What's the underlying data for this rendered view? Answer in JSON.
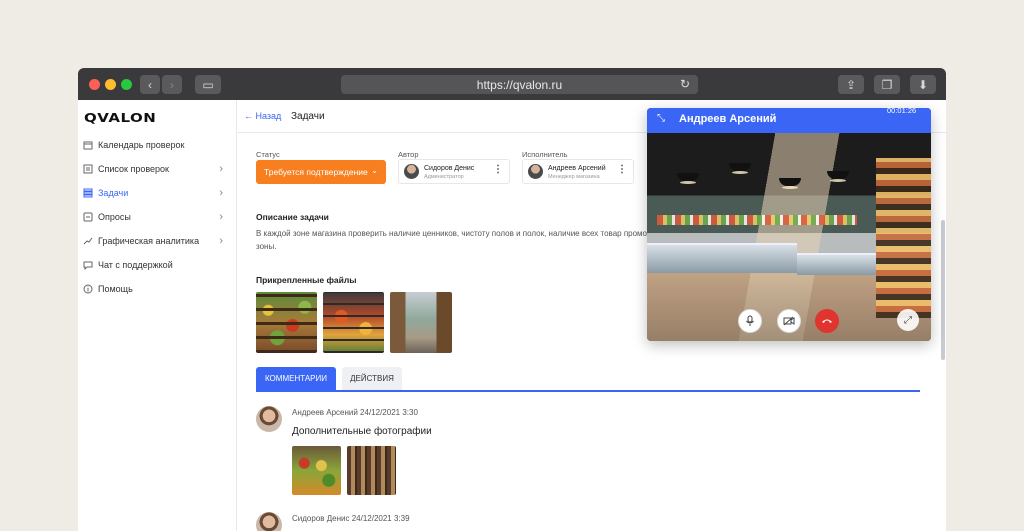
{
  "browser": {
    "url": "https://qvalon.ru"
  },
  "app": {
    "logo": "QVALON"
  },
  "sidebar": {
    "items": [
      {
        "label": "Календарь проверок",
        "icon": "calendar-icon"
      },
      {
        "label": "Список проверок",
        "icon": "checklist-icon"
      },
      {
        "label": "Задачи",
        "icon": "tasks-icon",
        "active": true
      },
      {
        "label": "Опросы",
        "icon": "survey-icon"
      },
      {
        "label": "Графическая аналитика",
        "icon": "chart-icon"
      },
      {
        "label": "Чат с поддержкой",
        "icon": "chat-icon"
      },
      {
        "label": "Помощь",
        "icon": "info-icon"
      }
    ]
  },
  "header": {
    "back_label": "Назад",
    "title": "Задачи"
  },
  "task": {
    "status_label": "Статус",
    "status_value": "Требуется подтверждение",
    "author_label": "Автор",
    "author": {
      "name": "Сидоров Денис",
      "role": "Администратор"
    },
    "assignee_label": "Исполнитель",
    "assignee": {
      "name": "Андреев Арсений",
      "role": "Менеджер магазина"
    },
    "description_title": "Описание задачи",
    "description": "В каждой зоне магазина проверить наличие ценников, чистоту полов и полок, наличие всех товар промо-зоны.",
    "files_title": "Прикрепленные файлы"
  },
  "tabs": [
    {
      "label": "КОММЕНТАРИИ",
      "active": true
    },
    {
      "label": "ДЕЙСТВИЯ",
      "active": false
    }
  ],
  "comments": [
    {
      "author_time": "Андреев Арсений 24/12/2021 3:30",
      "text": "Дополнительные фотографии"
    },
    {
      "author_time": "Сидоров Денис 24/12/2021 3:39",
      "text": ""
    }
  ],
  "call": {
    "name": "Андреев Арсений",
    "timer": "00:01:26"
  },
  "colors": {
    "accent": "#3b66f5",
    "status": "#f77f1f",
    "hangup": "#e0342f"
  }
}
